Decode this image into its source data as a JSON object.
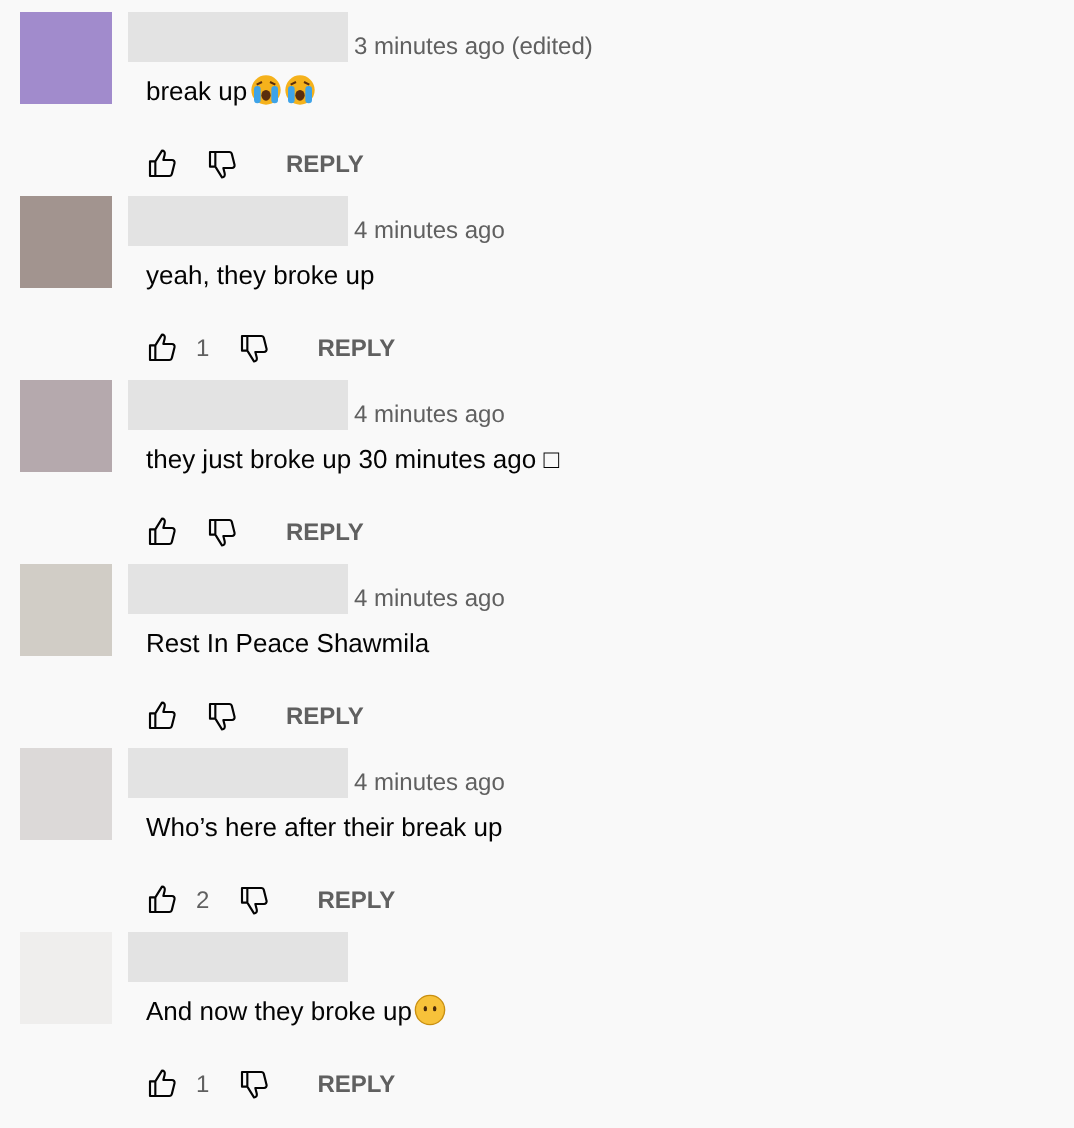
{
  "comments": [
    {
      "color": "#a18bcc",
      "time": "3 minutes ago (edited)",
      "text": "break up",
      "emojis": [
        {
          "kind": "crying"
        },
        {
          "kind": "crying"
        }
      ],
      "reply": "REPLY"
    },
    {
      "color": "#a2948f",
      "time": "4 minutes ago",
      "text": "yeah, they broke up",
      "likes": "1",
      "reply": "REPLY"
    },
    {
      "color": "#b5a9ad",
      "time": "4 minutes ago",
      "text": "they just broke up 30 minutes ago □",
      "reply": "REPLY"
    },
    {
      "color": "#d1cdc6",
      "time": "4 minutes ago",
      "text": "Rest In Peace Shawmila",
      "reply": "REPLY"
    },
    {
      "color": "#dcd9d8",
      "time": "4 minutes ago",
      "text": "Who’s here after their break up",
      "likes": "2",
      "reply": "REPLY"
    },
    {
      "color": "#efeeed",
      "text": "And now they broke up",
      "emojis": [
        {
          "kind": "speechless"
        }
      ],
      "likes": "1",
      "reply": "REPLY"
    }
  ]
}
